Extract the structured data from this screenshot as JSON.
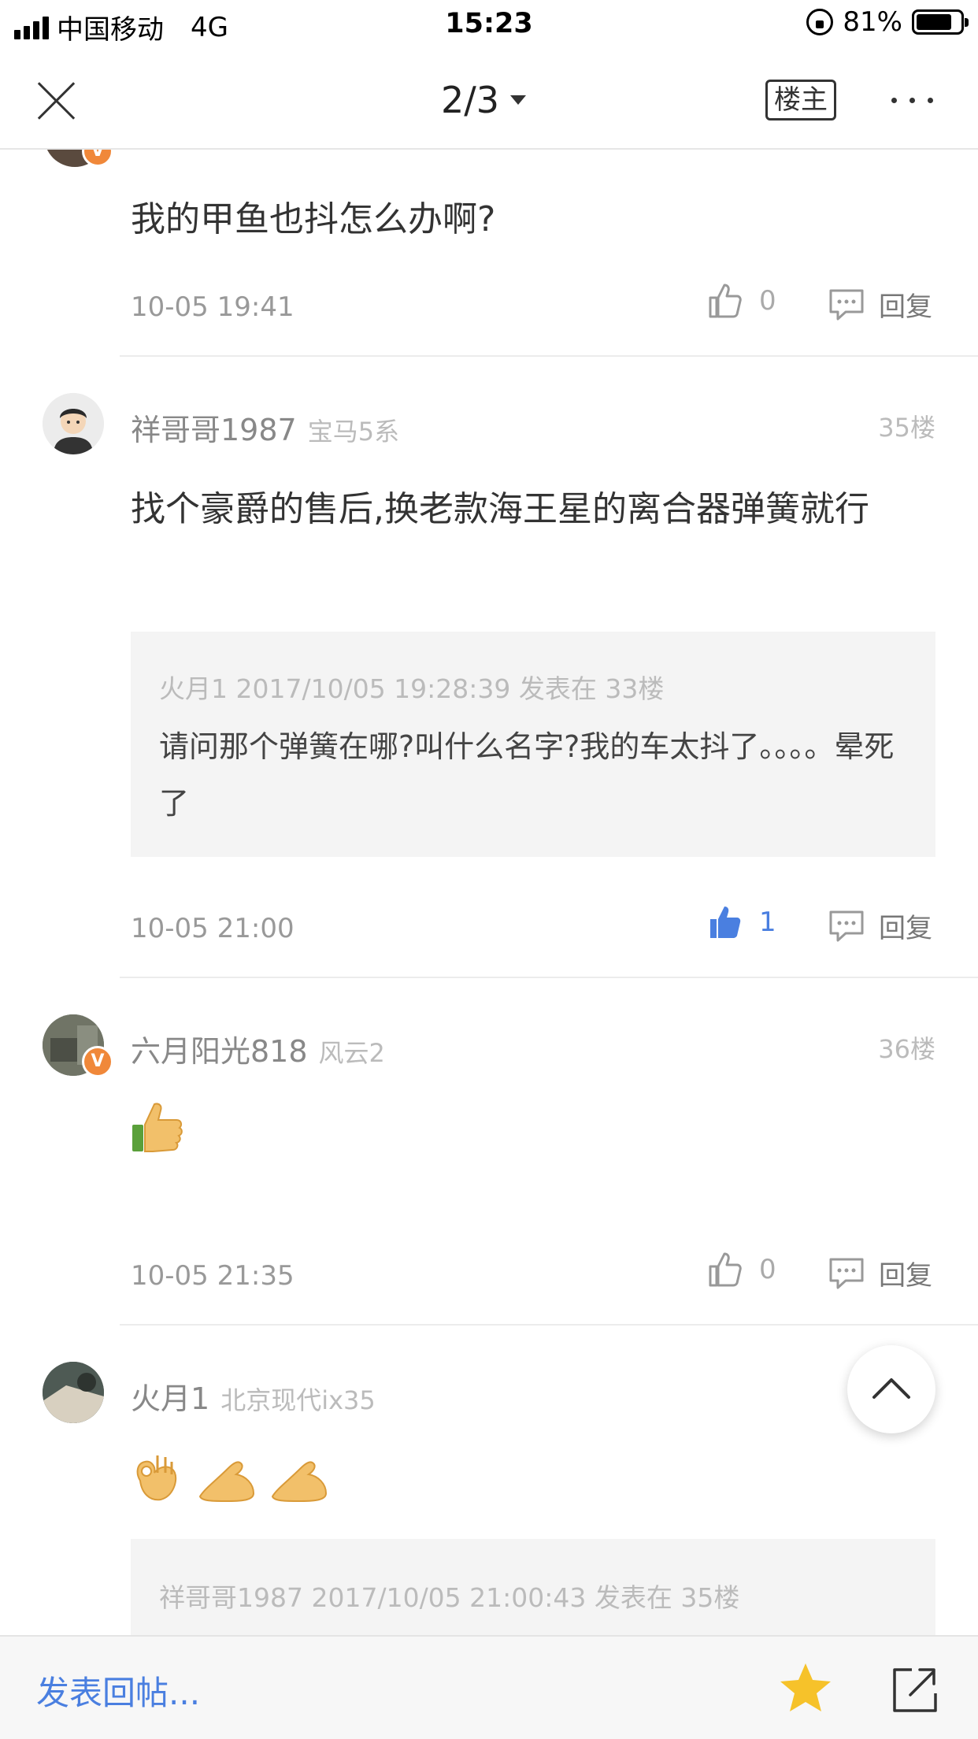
{
  "status_bar": {
    "carrier": "中国移动",
    "network": "4G",
    "time": "15:23",
    "battery": "81%",
    "battery_level": 0.81
  },
  "nav": {
    "page_indicator": "2/3",
    "owner_filter": "楼主"
  },
  "posts": [
    {
      "text": "我的甲鱼也抖怎么办啊?",
      "time": "10-05 19:41",
      "likes": "0",
      "reply_label": "回复"
    },
    {
      "username": "祥哥哥1987",
      "car": "宝马5系",
      "floor": "35楼",
      "text": "找个豪爵的售后,换老款海王星的离合器弹簧就行",
      "quote": {
        "meta": "火月1 2017/10/05 19:28:39 发表在 33楼",
        "text": "请问那个弹簧在哪?叫什么名字?我的车太抖了。。。。晕死了"
      },
      "time": "10-05 21:00",
      "likes": "1",
      "reply_label": "回复"
    },
    {
      "username": "六月阳光818",
      "car": "风云2",
      "floor": "36楼",
      "emoji": "thumbs-up",
      "time": "10-05 21:35",
      "likes": "0",
      "reply_label": "回复"
    },
    {
      "username": "火月1",
      "car": "北京现代ix35",
      "emoji": "ok-hand, bow, bow",
      "quote": {
        "meta": "祥哥哥1987 2017/10/05 21:00:43 发表在 35楼"
      }
    }
  ],
  "bottom_bar": {
    "reply_placeholder": "发表回帖..."
  },
  "colors": {
    "accent_blue": "#4a7fe0",
    "badge_orange": "#f0883a",
    "star_yellow": "#f6c22a"
  }
}
